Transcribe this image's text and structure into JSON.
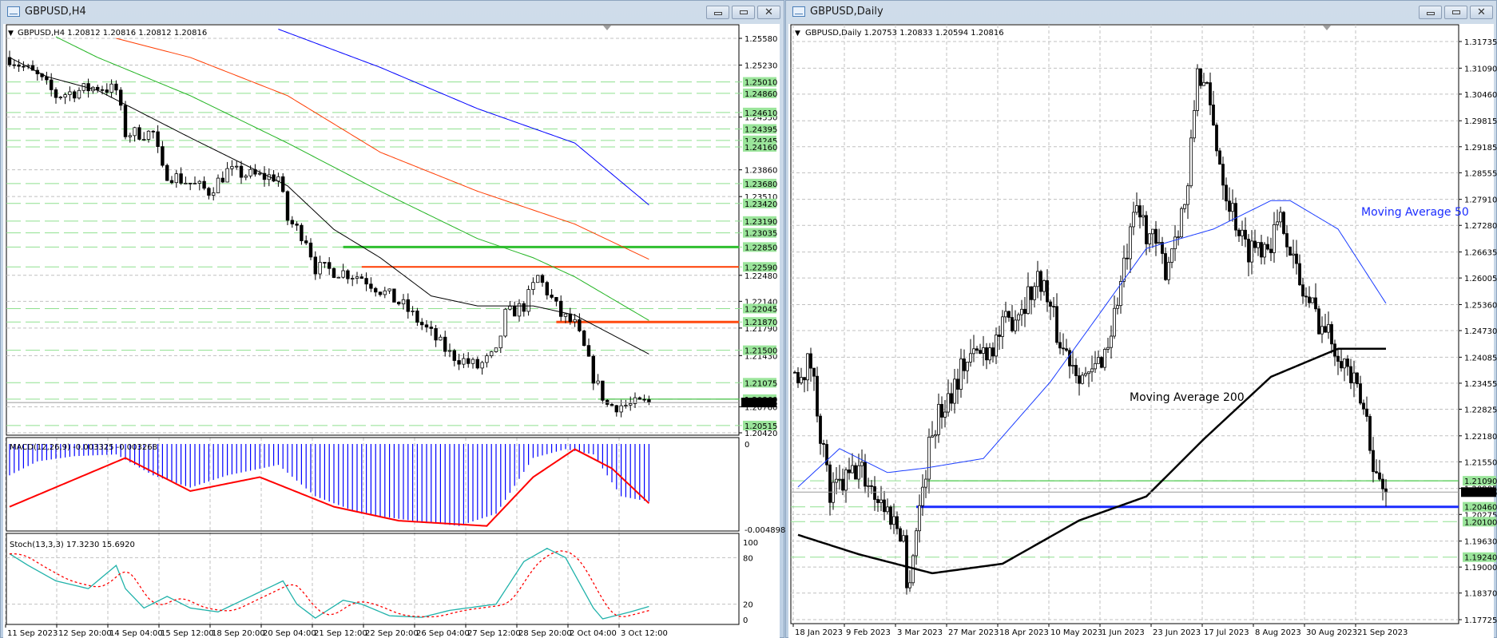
{
  "left": {
    "title": "GBPUSD,H4",
    "info": "GBPUSD,H4  1.20812 1.20816 1.20812 1.20816",
    "macd_label": "MACD(12,26,9) -0.003325 -0.003268",
    "stoch_label": "Stoch(13,3,3) 17.3230 15.6920",
    "price_ticks": [
      "1.25580",
      "1.25230",
      "1.24550",
      "1.23860",
      "1.23510",
      "1.22480",
      "1.22140",
      "1.21790",
      "1.21430",
      "1.20760",
      "1.20420"
    ],
    "level_labels": [
      "1.25010",
      "1.24860",
      "1.24610",
      "1.24395",
      "1.24245",
      "1.24160",
      "1.23680",
      "1.23420",
      "1.23190",
      "1.23035",
      "1.22850",
      "1.22590",
      "1.22045",
      "1.21870",
      "1.21500",
      "1.21075",
      "1.20860",
      "1.20515"
    ],
    "current_price": "1.20816",
    "macd_ticks": [
      "0",
      "-0.004898"
    ],
    "stoch_ticks": [
      "100",
      "80",
      "20",
      "0"
    ],
    "time_labels": [
      "11 Sep 2023",
      "12 Sep 20:00",
      "14 Sep 04:00",
      "15 Sep 12:00",
      "18 Sep 20:00",
      "20 Sep 04:00",
      "21 Sep 12:00",
      "22 Sep 20:00",
      "26 Sep 04:00",
      "27 Sep 12:00",
      "28 Sep 20:00",
      "2 Oct 04:00",
      "3 Oct 12:00"
    ],
    "chart_data": {
      "type": "candlestick",
      "bars": 138,
      "price_range": [
        1.2042,
        1.2558
      ],
      "close_path": [
        [
          0,
          1.2533
        ],
        [
          6,
          1.2508
        ],
        [
          10,
          1.2483
        ],
        [
          19,
          1.2495
        ],
        [
          23,
          1.249
        ],
        [
          25,
          1.2434
        ],
        [
          31,
          1.2434
        ],
        [
          33,
          1.2384
        ],
        [
          43,
          1.2358
        ],
        [
          47,
          1.2384
        ],
        [
          54,
          1.2377
        ],
        [
          58,
          1.2377
        ],
        [
          60,
          1.2321
        ],
        [
          64,
          1.2296
        ],
        [
          66,
          1.2258
        ],
        [
          72,
          1.2252
        ],
        [
          76,
          1.2246
        ],
        [
          85,
          1.2208
        ],
        [
          91,
          1.2171
        ],
        [
          95,
          1.2145
        ],
        [
          101,
          1.2128
        ],
        [
          105,
          1.2145
        ],
        [
          107,
          1.2196
        ],
        [
          111,
          1.2208
        ],
        [
          114,
          1.2246
        ],
        [
          116,
          1.2227
        ],
        [
          119,
          1.2196
        ],
        [
          122,
          1.2183
        ],
        [
          124,
          1.2152
        ],
        [
          126,
          1.2115
        ],
        [
          129,
          1.2078
        ],
        [
          134,
          1.2078
        ],
        [
          138,
          1.2082
        ]
      ],
      "moving_averages": [
        {
          "name": "MA blue",
          "color": "#0000ff",
          "points": [
            [
              58,
              1.257
            ],
            [
              80,
              1.252
            ],
            [
              101,
              1.2466
            ],
            [
              122,
              1.2421
            ],
            [
              138,
              1.234
            ]
          ]
        },
        {
          "name": "MA red",
          "color": "#ff3c00",
          "points": [
            [
              23,
              1.2558
            ],
            [
              39,
              1.2533
            ],
            [
              60,
              1.2483
            ],
            [
              80,
              1.2409
            ],
            [
              101,
              1.2358
            ],
            [
              122,
              1.2315
            ],
            [
              138,
              1.2269
            ]
          ]
        },
        {
          "name": "MA green",
          "color": "#22b422",
          "points": [
            [
              10,
              1.256
            ],
            [
              19,
              1.2533
            ],
            [
              39,
              1.2483
            ],
            [
              60,
              1.2421
            ],
            [
              80,
              1.2358
            ],
            [
              101,
              1.2296
            ],
            [
              113,
              1.2271
            ],
            [
              122,
              1.2246
            ],
            [
              138,
              1.2189
            ]
          ]
        },
        {
          "name": "MA black",
          "color": "#000000",
          "points": [
            [
              0,
              1.2533
            ],
            [
              8,
              1.2508
            ],
            [
              19,
              1.249
            ],
            [
              39,
              1.2428
            ],
            [
              60,
              1.2365
            ],
            [
              70,
              1.2308
            ],
            [
              80,
              1.2271
            ],
            [
              91,
              1.2221
            ],
            [
              101,
              1.2208
            ],
            [
              113,
              1.2208
            ],
            [
              122,
              1.2196
            ],
            [
              138,
              1.2145
            ]
          ]
        }
      ],
      "levels": [
        {
          "price": 1.2285,
          "from": 72,
          "color": "#2fbf2f",
          "width": 3
        },
        {
          "price": 1.2259,
          "from": 76,
          "color": "#ff3c00",
          "width": 2
        },
        {
          "price": 1.2187,
          "from": 118,
          "color": "#ff4a10",
          "width": 3
        },
        {
          "price": 1.2086,
          "from": 127,
          "color": "#22b422",
          "width": 1
        }
      ],
      "macd_hist": [
        [
          0,
          -0.0018
        ],
        [
          6,
          -0.001
        ],
        [
          14,
          -0.0007
        ],
        [
          23,
          -0.0006
        ],
        [
          31,
          -0.0018
        ],
        [
          39,
          -0.0025
        ],
        [
          47,
          -0.0018
        ],
        [
          58,
          -0.0012
        ],
        [
          66,
          -0.003
        ],
        [
          76,
          -0.004
        ],
        [
          87,
          -0.0044
        ],
        [
          97,
          -0.0047
        ],
        [
          105,
          -0.004
        ],
        [
          113,
          -0.0008
        ],
        [
          120,
          -0.0003
        ],
        [
          126,
          -0.0006
        ],
        [
          132,
          -0.003
        ],
        [
          138,
          -0.0033
        ]
      ],
      "macd_signal": [
        [
          0,
          -0.0036
        ],
        [
          25,
          -0.0008
        ],
        [
          39,
          -0.0027
        ],
        [
          54,
          -0.0019
        ],
        [
          70,
          -0.0036
        ],
        [
          84,
          -0.0044
        ],
        [
          103,
          -0.0047
        ],
        [
          113,
          -0.0019
        ],
        [
          122,
          -0.0003
        ],
        [
          130,
          -0.0014
        ],
        [
          138,
          -0.0034
        ]
      ],
      "macd_range": [
        -0.004898,
        0.0004
      ],
      "stoch_main": [
        [
          0,
          85
        ],
        [
          4,
          70
        ],
        [
          10,
          50
        ],
        [
          17,
          40
        ],
        [
          23,
          70
        ],
        [
          25,
          40
        ],
        [
          29,
          15
        ],
        [
          34,
          30
        ],
        [
          39,
          15
        ],
        [
          45,
          10
        ],
        [
          52,
          30
        ],
        [
          59,
          50
        ],
        [
          62,
          20
        ],
        [
          66,
          2
        ],
        [
          72,
          25
        ],
        [
          76,
          20
        ],
        [
          82,
          5
        ],
        [
          89,
          3
        ],
        [
          95,
          12
        ],
        [
          105,
          20
        ],
        [
          111,
          75
        ],
        [
          116,
          92
        ],
        [
          120,
          80
        ],
        [
          126,
          15
        ],
        [
          128,
          1
        ],
        [
          134,
          10
        ],
        [
          138,
          17
        ]
      ]
    }
  },
  "right": {
    "title": "GBPUSD,Daily",
    "info": "GBPUSD,Daily  1.20753 1.20833 1.20594 1.20816",
    "ma50_label": "Moving Average 50",
    "ma200_label": "Moving Average 200",
    "price_ticks": [
      "1.31735",
      "1.31090",
      "1.30460",
      "1.29815",
      "1.29185",
      "1.28555",
      "1.27910",
      "1.27280",
      "1.26635",
      "1.26005",
      "1.25360",
      "1.24730",
      "1.24085",
      "1.23455",
      "1.22825",
      "1.22180",
      "1.21550",
      "1.20905",
      "1.20275",
      "1.19630",
      "1.19000",
      "1.18370",
      "1.17725"
    ],
    "level_labels": [
      "1.21090",
      "1.20460",
      "1.20100",
      "1.19240"
    ],
    "current_price": "1.20816",
    "time_labels": [
      "18 Jan 2023",
      "9 Feb 2023",
      "3 Mar 2023",
      "27 Mar 2023",
      "18 Apr 2023",
      "10 May 2023",
      "1 Jun 2023",
      "23 Jun 2023",
      "17 Jul 2023",
      "8 Aug 2023",
      "30 Aug 2023",
      "21 Sep 2023"
    ],
    "chart_data": {
      "type": "candlestick",
      "bars": 185,
      "price_range": [
        1.17725,
        1.31735
      ],
      "close_path": [
        [
          0,
          1.2372
        ],
        [
          5,
          1.2395
        ],
        [
          11,
          1.2071
        ],
        [
          20,
          1.214
        ],
        [
          34,
          1.1978
        ],
        [
          35,
          1.184
        ],
        [
          40,
          1.2094
        ],
        [
          43,
          1.2233
        ],
        [
          53,
          1.2396
        ],
        [
          62,
          1.2442
        ],
        [
          77,
          1.2603
        ],
        [
          83,
          1.2442
        ],
        [
          92,
          1.2349
        ],
        [
          98,
          1.2442
        ],
        [
          107,
          1.2765
        ],
        [
          116,
          1.2626
        ],
        [
          123,
          1.2812
        ],
        [
          126,
          1.3112
        ],
        [
          129,
          1.3042
        ],
        [
          135,
          1.2812
        ],
        [
          141,
          1.2672
        ],
        [
          149,
          1.2696
        ],
        [
          153,
          1.2742
        ],
        [
          158,
          1.258
        ],
        [
          165,
          1.2487
        ],
        [
          171,
          1.2417
        ],
        [
          179,
          1.2257
        ],
        [
          182,
          1.2117
        ],
        [
          185,
          1.2081
        ]
      ],
      "moving_averages": [
        {
          "name": "Moving Average 50",
          "color": "#1a3cff",
          "points": [
            [
              1,
              1.2094
            ],
            [
              14,
              1.2187
            ],
            [
              29,
              1.2129
            ],
            [
              41,
              1.214
            ],
            [
              59,
              1.2163
            ],
            [
              80,
              1.2349
            ],
            [
              95,
              1.251
            ],
            [
              110,
              1.2672
            ],
            [
              131,
              1.2719
            ],
            [
              149,
              1.2788
            ],
            [
              155,
              1.2788
            ],
            [
              170,
              1.2719
            ],
            [
              185,
              1.2539
            ]
          ]
        },
        {
          "name": "Moving Average 200",
          "color": "#000000",
          "points": [
            [
              1,
              1.1978
            ],
            [
              20,
              1.1931
            ],
            [
              43,
              1.1885
            ],
            [
              65,
              1.1908
            ],
            [
              89,
              1.2013
            ],
            [
              110,
              1.2071
            ],
            [
              128,
              1.221
            ],
            [
              149,
              1.2361
            ],
            [
              170,
              1.2429
            ],
            [
              185,
              1.2429
            ]
          ]
        }
      ],
      "levels": [
        {
          "price": 1.2109,
          "from": 41,
          "color": "#2fbf2f",
          "width": 1
        },
        {
          "price": 1.2046,
          "from": 38,
          "color": "#1a2cff",
          "width": 3
        }
      ]
    }
  },
  "colors": {
    "grid": "#c0c0c0",
    "level": "#8fe08f",
    "label_bg": "#9be59b",
    "macd_hist": "#0000ff",
    "macd_signal": "#ff0000",
    "stoch_main": "#20b2aa",
    "stoch_signal": "#ff0000"
  }
}
